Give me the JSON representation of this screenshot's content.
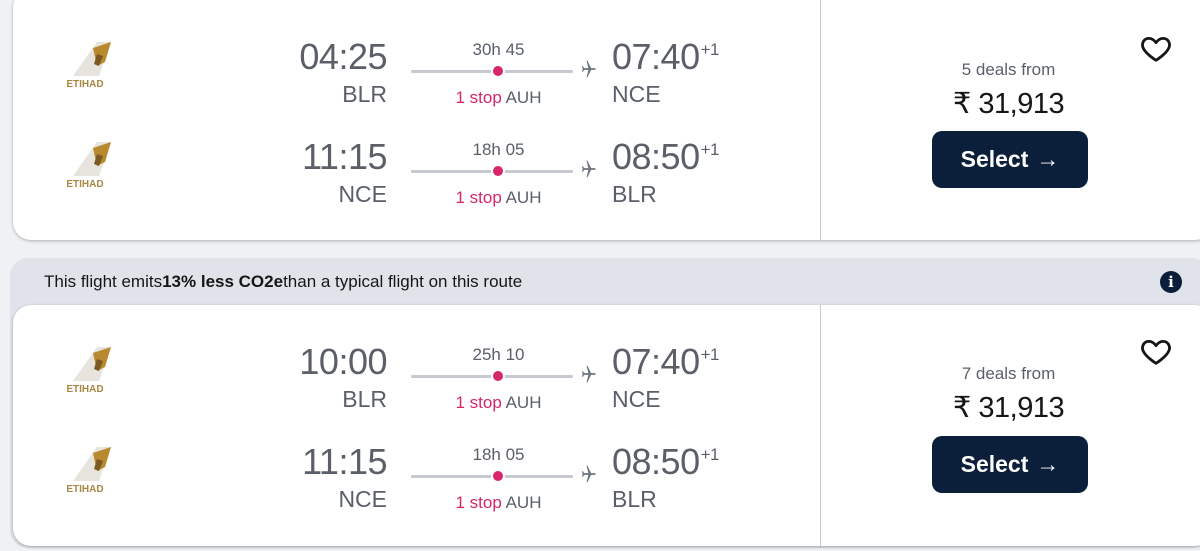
{
  "colors": {
    "accent_red": "#d7266a",
    "button_navy": "#0b1f3a",
    "muted_text": "#5a5f68"
  },
  "results": [
    {
      "deals_text": "5 deals from",
      "price": "₹ 31,913",
      "select_label": "Select",
      "select_icon": "arrow-right-icon",
      "save_icon": "heart-outline-icon",
      "legs": [
        {
          "airline": "ETIHAD",
          "dep_time": "04:25",
          "dep_code": "BLR",
          "duration": "30h 45",
          "stops_label": "1 stop",
          "stop_airport": "AUH",
          "arr_time": "07:40",
          "day_offset": "+1",
          "arr_code": "NCE"
        },
        {
          "airline": "ETIHAD",
          "dep_time": "11:15",
          "dep_code": "NCE",
          "duration": "18h 05",
          "stops_label": "1 stop",
          "stop_airport": "AUH",
          "arr_time": "08:50",
          "day_offset": "+1",
          "arr_code": "BLR"
        }
      ]
    },
    {
      "eco_banner": {
        "prefix": "This flight emits ",
        "highlight": "13% less CO2e",
        "suffix": " than a typical flight on this route",
        "icon": "info-icon"
      },
      "deals_text": "7 deals from",
      "price": "₹ 31,913",
      "select_label": "Select",
      "select_icon": "arrow-right-icon",
      "save_icon": "heart-outline-icon",
      "legs": [
        {
          "airline": "ETIHAD",
          "dep_time": "10:00",
          "dep_code": "BLR",
          "duration": "25h 10",
          "stops_label": "1 stop",
          "stop_airport": "AUH",
          "arr_time": "07:40",
          "day_offset": "+1",
          "arr_code": "NCE"
        },
        {
          "airline": "ETIHAD",
          "dep_time": "11:15",
          "dep_code": "NCE",
          "duration": "18h 05",
          "stops_label": "1 stop",
          "stop_airport": "AUH",
          "arr_time": "08:50",
          "day_offset": "+1",
          "arr_code": "BLR"
        }
      ]
    }
  ]
}
